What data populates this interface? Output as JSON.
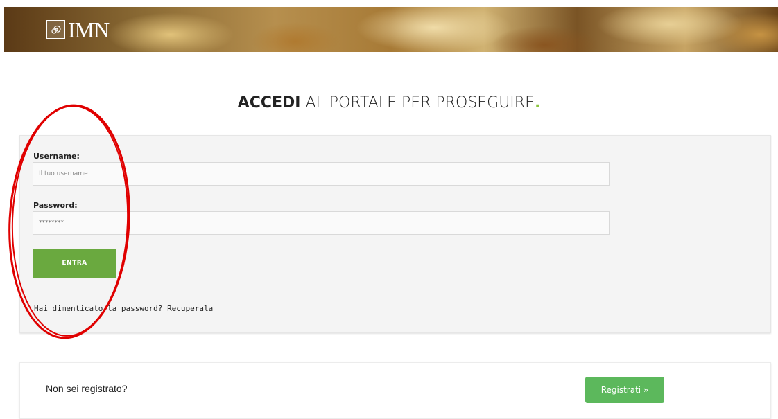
{
  "header": {
    "logo_text": "IMN",
    "logo_icon": "spiral-icon"
  },
  "title": {
    "bold": "ACCEDI",
    "rest": " AL PORTALE PER PROSEGUIRE",
    "dot": "."
  },
  "login": {
    "username_label": "Username:",
    "username_placeholder": "Il tuo username",
    "username_value": "",
    "password_label": "Password:",
    "password_value": "********",
    "submit_label": "ENTRA",
    "forgot_text": "Hai dimenticato la password? ",
    "forgot_link": "Recuperala"
  },
  "register": {
    "prompt": "Non sei registrato?",
    "button_label": "Registrati »"
  },
  "colors": {
    "accent_green": "#6aa93f",
    "register_green": "#5cb85c",
    "annotation_red": "#e00000",
    "title_dot": "#8cc63f"
  }
}
